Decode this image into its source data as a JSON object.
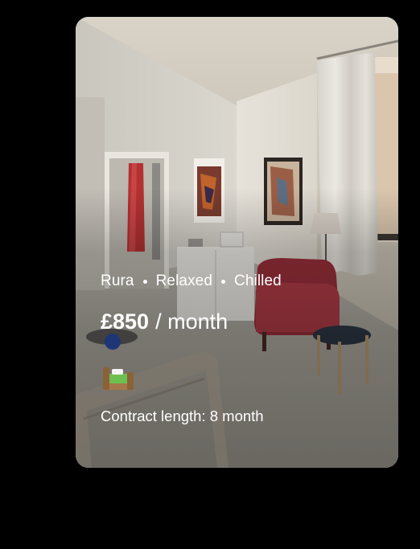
{
  "listing": {
    "tags": [
      "Rura",
      "Relaxed",
      "Chilled"
    ],
    "price_amount": "£850",
    "price_period": "/ month",
    "amenity_icon": "bed-icon",
    "contract": "Contract length: 8 month"
  }
}
